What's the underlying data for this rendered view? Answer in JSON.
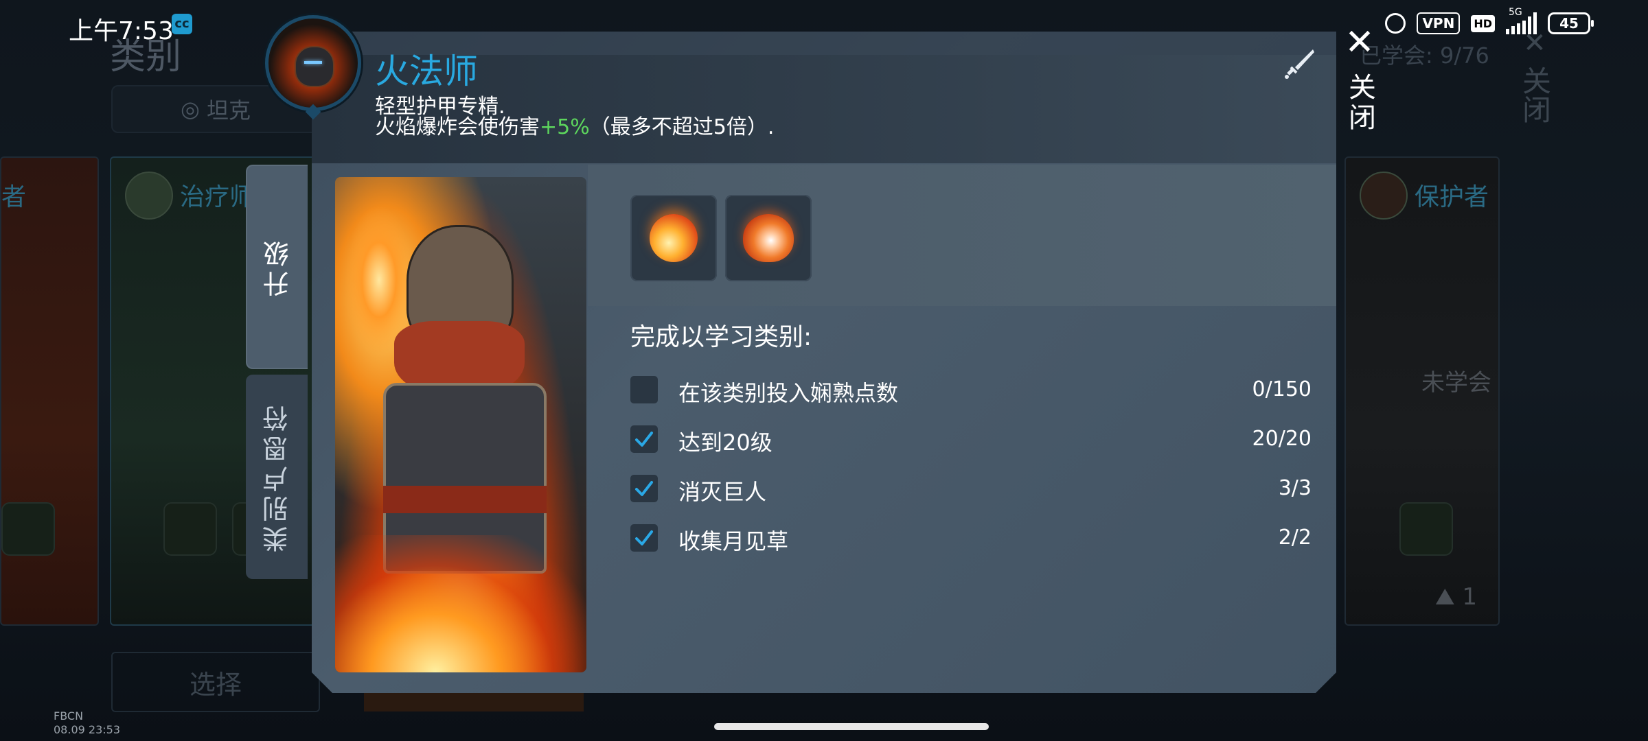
{
  "status_bar": {
    "time": "上午7:53",
    "app_icon": "cc-app-icon",
    "vpn": "VPN",
    "hd": "HD",
    "network": "5G",
    "battery": "45"
  },
  "background": {
    "title": "类别",
    "tab_tank": "坦克",
    "learned_count": "已学会: 9/76",
    "close_label": "关闭",
    "card_mid_name": "治疗师",
    "card_right_name": "保护者",
    "card_right_status": "未学会",
    "card_right_badge": "1",
    "card_left_name": "者",
    "select_label": "选择"
  },
  "modal": {
    "hero_name": "火法师",
    "desc_line1": "轻型护甲专精.",
    "desc_line2_before": "火焰爆炸会使伤害",
    "desc_line2_highlight": "+5%",
    "desc_line2_after": "（最多不超过5倍）.",
    "close_label": "关闭",
    "tabs": [
      {
        "label": "升级",
        "active": true
      },
      {
        "label": "类别卢恩符",
        "active": false
      }
    ],
    "upgrade_icons": [
      "fireball-icon",
      "fire-swirl-icon"
    ],
    "requirements_title": "完成以学习类别:",
    "requirements": [
      {
        "label": "在该类别投入娴熟点数",
        "count": "0/150",
        "done": false
      },
      {
        "label": "达到20级",
        "count": "20/20",
        "done": true
      },
      {
        "label": "消灭巨人",
        "count": "3/3",
        "done": true
      },
      {
        "label": "收集月见草",
        "count": "2/2",
        "done": true
      }
    ]
  },
  "watermark": {
    "line1": "FBCN",
    "line2": "08.09 23:53"
  },
  "colors": {
    "accent_blue": "#29a9e0",
    "check_blue": "#2aa8e6",
    "bonus_green": "#5dd65d"
  }
}
